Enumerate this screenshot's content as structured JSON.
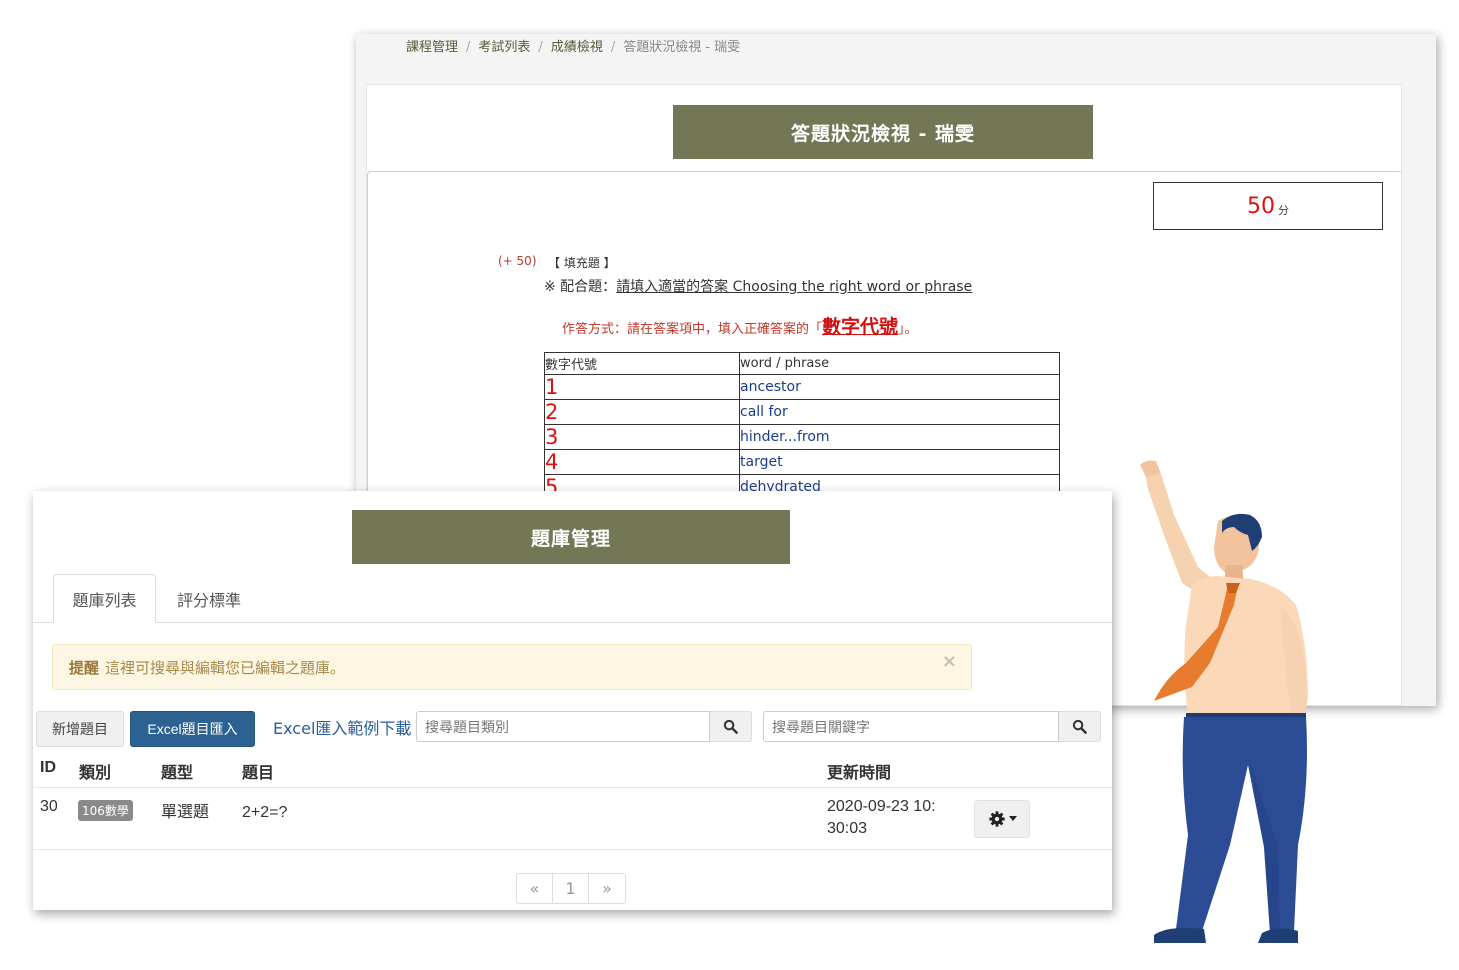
{
  "back_window": {
    "breadcrumb": [
      "課程管理",
      "考試列表",
      "成績檢視",
      "答題狀況檢視 - 瑞雯"
    ],
    "banner_title": "答題狀況檢視 - 瑞雯",
    "score": {
      "value": "50",
      "unit": "分"
    },
    "question": {
      "points": "(+ 50)",
      "type": "【 填充題 】",
      "instruction_prefix": "※ 配合題：",
      "instruction_text": "請填入適當的答案  Choosing the right word or phrase",
      "method_prefix": "作答方式：請在答案項中，填入正確答案的「",
      "method_key": "數字代號",
      "method_suffix": "」。"
    },
    "word_table": {
      "headers": [
        "數字代號",
        "word / phrase"
      ],
      "rows": [
        {
          "num": "1",
          "word": "ancestor"
        },
        {
          "num": "2",
          "word": "call for"
        },
        {
          "num": "3",
          "word": "hinder...from"
        },
        {
          "num": "4",
          "word": "target"
        },
        {
          "num": "5",
          "word": "dehydrated"
        }
      ]
    }
  },
  "front_window": {
    "banner_title": "題庫管理",
    "tabs": [
      {
        "label": "題庫列表",
        "active": true
      },
      {
        "label": "評分標準",
        "active": false
      }
    ],
    "alert": {
      "strong": "提醒",
      "text": "這裡可搜尋與編輯您已編輯之題庫。",
      "close": "×"
    },
    "toolbar": {
      "add_label": "新增題目",
      "excel_import_label": "Excel題目匯入",
      "excel_sample_label": "Excel匯入範例下載",
      "category_placeholder": "搜尋題目類別",
      "keyword_placeholder": "搜尋題目關鍵字"
    },
    "table": {
      "headers": [
        "ID",
        "類別",
        "題型",
        "題目",
        "更新時間"
      ],
      "rows": [
        {
          "id": "30",
          "category": "106數學",
          "type": "單選題",
          "question": "2+2=?",
          "updated_line1": "2020-09-23 10:",
          "updated_line2": "30:03"
        }
      ]
    },
    "pagination": [
      "«",
      "1",
      "»"
    ]
  },
  "colors": {
    "banner": "#737756",
    "primary_button": "#2c6291",
    "alert_bg": "#fcf6e3",
    "score_red": "#e01010",
    "link_blue": "#2b5d9c"
  }
}
